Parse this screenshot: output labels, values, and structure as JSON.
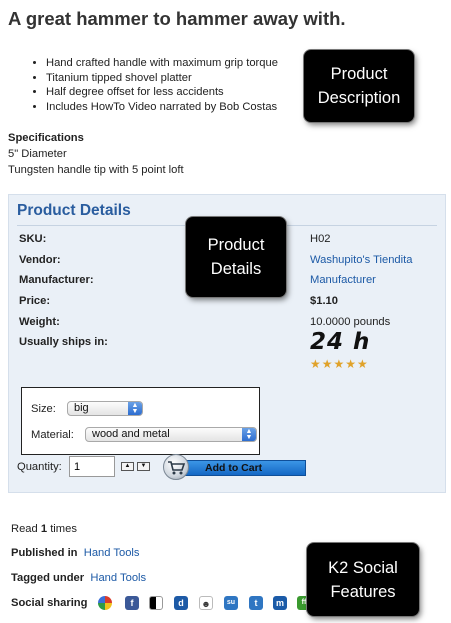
{
  "product": {
    "title": "A great hammer to hammer away with.",
    "bullets": [
      "Hand crafted handle with maximum grip torque",
      "Titanium tipped shovel platter",
      "Half degree offset for less accidents",
      "Includes HowTo Video narrated by Bob Costas"
    ],
    "specs": {
      "heading": "Specifications",
      "lines": [
        "5\" Diameter",
        "Tungsten handle tip with 5 point loft"
      ]
    }
  },
  "details": {
    "heading": "Product Details",
    "rows": [
      {
        "label": "SKU:",
        "value": "H02"
      },
      {
        "label": "Vendor:",
        "value": "Washupito's Tiendita"
      },
      {
        "label": "Manufacturer:",
        "value": "Manufacturer"
      },
      {
        "label": "Price:",
        "value": "$1.10"
      },
      {
        "label": "Weight:",
        "value": "10.0000 pounds"
      },
      {
        "label": "Usually ships in:",
        "value": "24 h"
      }
    ],
    "rating": {
      "stars": 5,
      "max": 5,
      "glyphs": "★★★★★"
    },
    "size": {
      "label": "Size:",
      "selected": "big"
    },
    "material": {
      "label": "Material:",
      "selected": "wood and metal"
    },
    "quantity": {
      "label": "Quantity:",
      "value": "1"
    },
    "cart_button": "Add to Cart"
  },
  "meta": {
    "read_prefix": "Read",
    "read_count": "1",
    "read_suffix": "times",
    "published_label": "Published in",
    "published_value": "Hand Tools",
    "tagged_label": "Tagged under",
    "tagged_value": "Hand Tools",
    "social_label": "Social sharing"
  },
  "social_icons": [
    {
      "name": "google-bookmarks-icon",
      "color": "#e8e8e8"
    },
    {
      "name": "facebook-icon",
      "color": "#3b5998",
      "glyph": "f"
    },
    {
      "name": "delicious-icon",
      "color": "#ffffff"
    },
    {
      "name": "digg-icon",
      "color": "#1d5aa6",
      "glyph": "d"
    },
    {
      "name": "reddit-icon",
      "color": "#ffffff"
    },
    {
      "name": "stumbleupon-icon",
      "color": "#2f76c2",
      "glyph": "su"
    },
    {
      "name": "technorati-icon",
      "color": "#2f76c2",
      "glyph": "t"
    },
    {
      "name": "myspace-icon",
      "color": "#1b5ba8",
      "glyph": "m"
    },
    {
      "name": "friendfeed-icon",
      "color": "#3a9a2f",
      "glyph": "ff"
    }
  ],
  "callouts": {
    "description": "Product Description",
    "details": "Product Details",
    "social": "K2 Social Features"
  }
}
